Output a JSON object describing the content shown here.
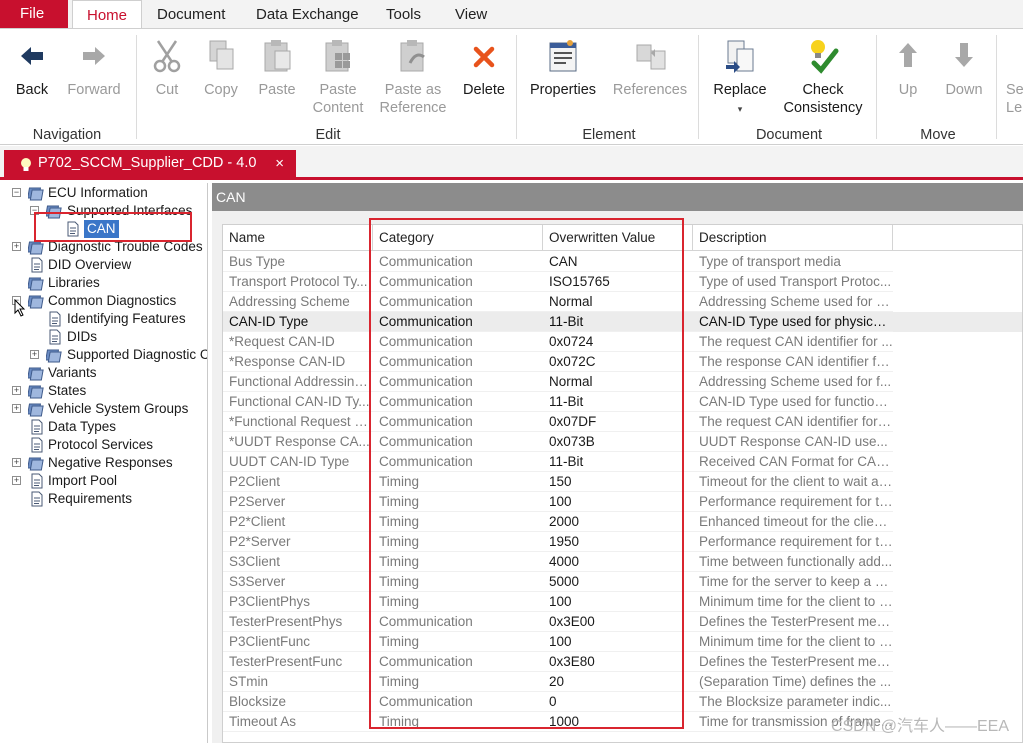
{
  "ribbon": {
    "file_label": "File",
    "tabs": [
      {
        "label": "Home"
      },
      {
        "label": "Document"
      },
      {
        "label": "Data Exchange"
      },
      {
        "label": "Tools"
      },
      {
        "label": "View"
      }
    ],
    "buttons": {
      "back": "Back",
      "forward": "Forward",
      "cut": "Cut",
      "copy": "Copy",
      "paste": "Paste",
      "paste_content_1": "Paste",
      "paste_content_2": "Content",
      "paste_ref_1": "Paste as",
      "paste_ref_2": "Reference",
      "delete": "Delete",
      "properties": "Properties",
      "references": "References",
      "replace": "Replace",
      "check_1": "Check",
      "check_2": "Consistency",
      "up": "Up",
      "down": "Down",
      "cut_off_1": "Se",
      "cut_off_2": "Le"
    },
    "groups": {
      "navigation": "Navigation",
      "edit": "Edit",
      "element": "Element",
      "document": "Document",
      "move": "Move"
    }
  },
  "doc_tab": {
    "title": "P702_SCCM_Supplier_CDD - 4.0",
    "close": "×"
  },
  "tree": {
    "ecu_information": "ECU Information",
    "supported_interfaces": "Supported Interfaces",
    "can": "CAN",
    "dtc": "Diagnostic Trouble Codes",
    "did_overview": "DID Overview",
    "libraries": "Libraries",
    "common_diagnostics": "Common Diagnostics",
    "identifying_features": "Identifying Features",
    "dids": "DIDs",
    "supported_diag": "Supported Diagnostic C",
    "variants": "Variants",
    "states": "States",
    "vehicle_system_groups": "Vehicle System Groups",
    "data_types": "Data Types",
    "protocol_services": "Protocol Services",
    "negative_responses": "Negative Responses",
    "import_pool": "Import Pool",
    "requirements": "Requirements"
  },
  "panel": {
    "title": "CAN",
    "columns": {
      "name": "Name",
      "category": "Category",
      "value": "Overwritten Value",
      "description": "Description"
    },
    "rows": [
      {
        "name": "Bus Type",
        "category": "Communication",
        "value": "CAN",
        "description": "Type of transport media"
      },
      {
        "name": "Transport Protocol Ty...",
        "category": "Communication",
        "value": "ISO15765",
        "description": "Type of used Transport Protoc..."
      },
      {
        "name": "Addressing Scheme",
        "category": "Communication",
        "value": "Normal",
        "description": "Addressing Scheme used for p..."
      },
      {
        "name": "CAN-ID Type",
        "category": "Communication",
        "value": "11-Bit",
        "description": "CAN-ID Type used for physical..."
      },
      {
        "name": "*Request CAN-ID",
        "category": "Communication",
        "value": "0x0724",
        "description": "The request CAN identifier for ..."
      },
      {
        "name": "*Response CAN-ID",
        "category": "Communication",
        "value": "0x072C",
        "description": "The response CAN identifier fo..."
      },
      {
        "name": "Functional Addressing...",
        "category": "Communication",
        "value": "Normal",
        "description": "Addressing Scheme used for f..."
      },
      {
        "name": "Functional CAN-ID Ty...",
        "category": "Communication",
        "value": "11-Bit",
        "description": "CAN-ID Type used for function..."
      },
      {
        "name": "*Functional Request C...",
        "category": "Communication",
        "value": "0x07DF",
        "description": "The request CAN identifier for f..."
      },
      {
        "name": "*UUDT Response CA...",
        "category": "Communication",
        "value": "0x073B",
        "description": "UUDT Response CAN-ID use..."
      },
      {
        "name": "UUDT CAN-ID Type",
        "category": "Communication",
        "value": "11-Bit",
        "description": "Received CAN Format for CAN..."
      },
      {
        "name": "P2Client",
        "category": "Timing",
        "value": "150",
        "description": "Timeout for the client to wait aft..."
      },
      {
        "name": "P2Server",
        "category": "Timing",
        "value": "100",
        "description": "Performance requirement for th..."
      },
      {
        "name": "P2*Client",
        "category": "Timing",
        "value": "2000",
        "description": "Enhanced timeout for the client ..."
      },
      {
        "name": "P2*Server",
        "category": "Timing",
        "value": "1950",
        "description": "Performance requirement for th..."
      },
      {
        "name": "S3Client",
        "category": "Timing",
        "value": "4000",
        "description": "Time between functionally add..."
      },
      {
        "name": "S3Server",
        "category": "Timing",
        "value": "5000",
        "description": "Time for the server to keep a di..."
      },
      {
        "name": "P3ClientPhys",
        "category": "Timing",
        "value": "100",
        "description": "Minimum time for the client to w..."
      },
      {
        "name": "TesterPresentPhys",
        "category": "Communication",
        "value": "0x3E00",
        "description": "Defines the TesterPresent mes..."
      },
      {
        "name": "P3ClientFunc",
        "category": "Timing",
        "value": "100",
        "description": "Minimum time for the client to w..."
      },
      {
        "name": "TesterPresentFunc",
        "category": "Communication",
        "value": "0x3E80",
        "description": "Defines the TesterPresent mes..."
      },
      {
        "name": "STmin",
        "category": "Timing",
        "value": "20",
        "description": "(Separation Time) defines the ..."
      },
      {
        "name": "Blocksize",
        "category": "Communication",
        "value": "0",
        "description": "The Blocksize parameter indic..."
      },
      {
        "name": "Timeout As",
        "category": "Timing",
        "value": "1000",
        "description": "Time for transmission of frame..."
      }
    ]
  },
  "watermark": "CSDN @汽车人——EEA",
  "colors": {
    "accent_red": "#c8102e",
    "highlight_box": "#d9252f",
    "selection_blue": "#3a76c8"
  }
}
